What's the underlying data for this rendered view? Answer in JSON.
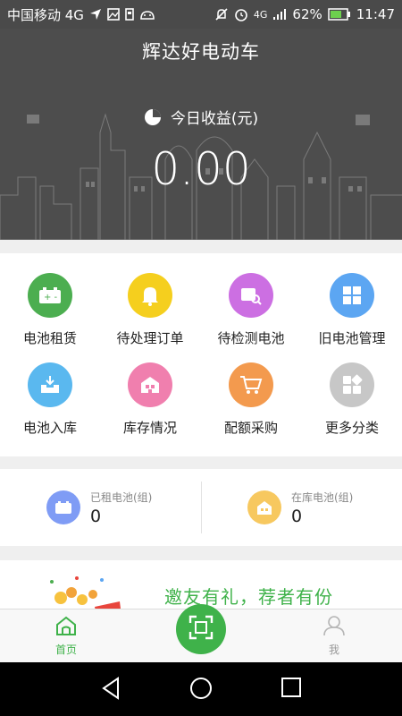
{
  "status_bar": {
    "carrier": "中国移动 4G",
    "network": "4G",
    "battery": "62%",
    "time": "11:47"
  },
  "header": {
    "title": "辉达好电动车",
    "income_label": "今日收益(元)",
    "income_value": "0.00"
  },
  "grid": [
    {
      "label": "电池租赁",
      "color": "#4cae50",
      "icon": "battery-icon"
    },
    {
      "label": "待处理订单",
      "color": "#f5cf1e",
      "icon": "bell-icon"
    },
    {
      "label": "待检测电池",
      "color": "#cc6fe2",
      "icon": "battery-check-icon"
    },
    {
      "label": "旧电池管理",
      "color": "#5ca6f2",
      "icon": "grid-manage-icon"
    },
    {
      "label": "电池入库",
      "color": "#5ab8ef",
      "icon": "inbox-icon"
    },
    {
      "label": "库存情况",
      "color": "#f07fae",
      "icon": "warehouse-icon"
    },
    {
      "label": "配额采购",
      "color": "#f39a4e",
      "icon": "cart-icon"
    },
    {
      "label": "更多分类",
      "color": "#c7c7c7",
      "icon": "more-icon"
    }
  ],
  "stats": [
    {
      "label": "已租电池(组)",
      "value": "0",
      "color": "#7f9cf5"
    },
    {
      "label": "在库电池(组)",
      "value": "0",
      "color": "#f7c85f"
    }
  ],
  "banner": {
    "text": "邀友有礼，荐者有份"
  },
  "tabs": {
    "home": "首页",
    "me": "我"
  },
  "colors": {
    "accent": "#3fb24a",
    "header_bg": "#4d4d4d"
  }
}
